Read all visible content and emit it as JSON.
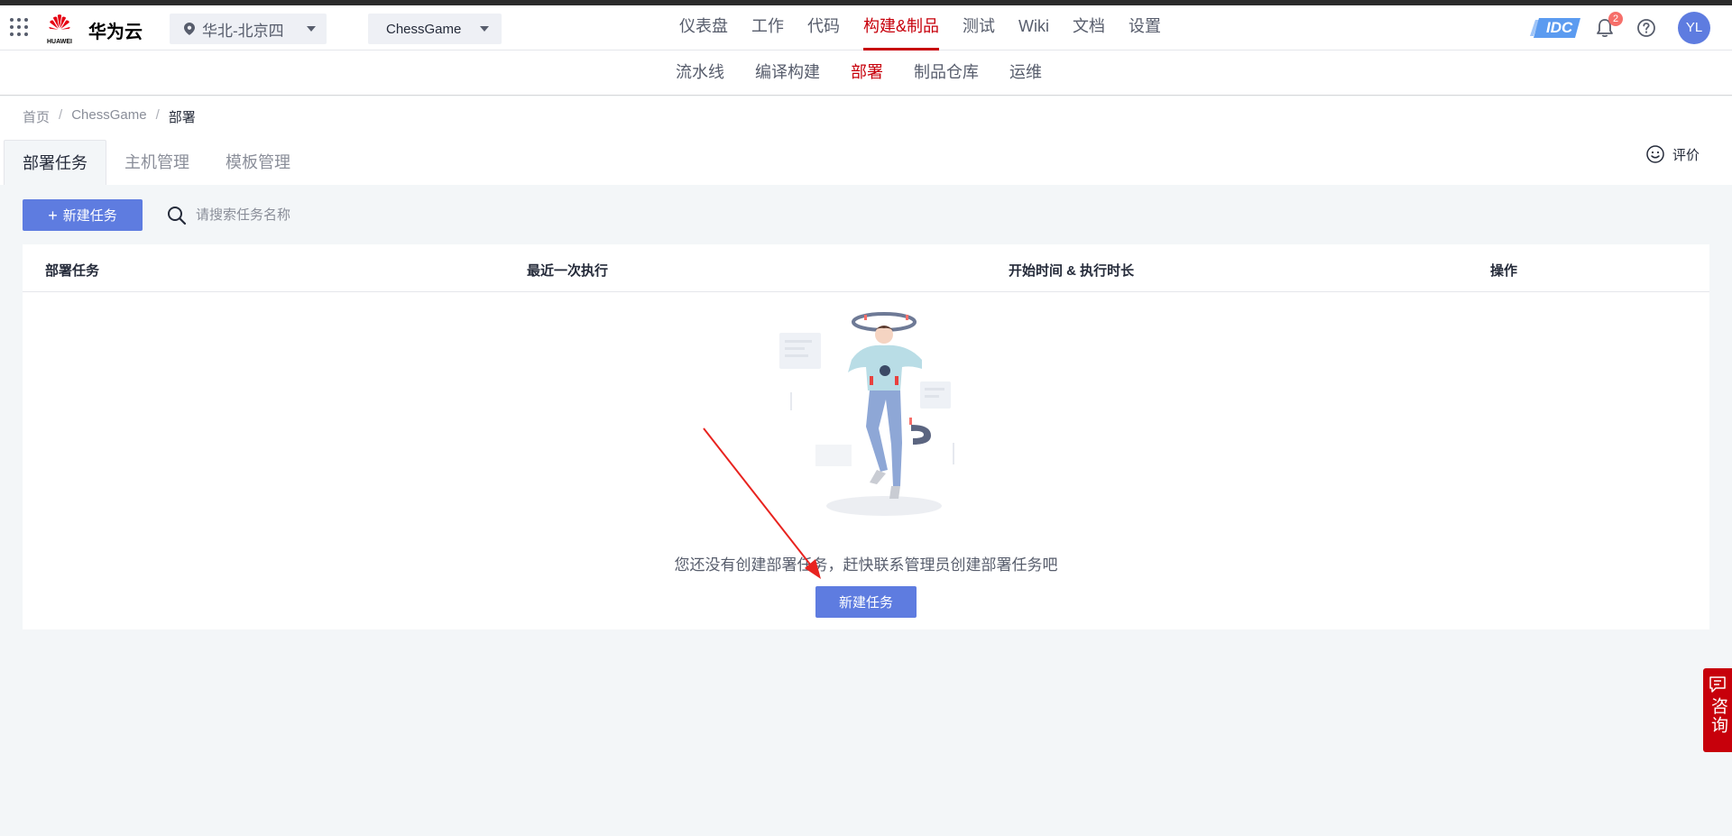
{
  "header": {
    "brand_text": "华为云",
    "logo_caption": "HUAWEI",
    "region": "华北-北京四",
    "project": "ChessGame",
    "menu": [
      {
        "label": "仪表盘",
        "active": false
      },
      {
        "label": "工作",
        "active": false
      },
      {
        "label": "代码",
        "active": false
      },
      {
        "label": "构建&制品",
        "active": true
      },
      {
        "label": "测试",
        "active": false
      },
      {
        "label": "Wiki",
        "active": false
      },
      {
        "label": "文档",
        "active": false
      },
      {
        "label": "设置",
        "active": false
      }
    ],
    "idc_badge": "IDC",
    "notification_count": "2",
    "avatar_initials": "YL"
  },
  "subnav": {
    "items": [
      {
        "label": "流水线",
        "active": false
      },
      {
        "label": "编译构建",
        "active": false
      },
      {
        "label": "部署",
        "active": true
      },
      {
        "label": "制品仓库",
        "active": false
      },
      {
        "label": "运维",
        "active": false
      }
    ]
  },
  "breadcrumb": {
    "home": "首页",
    "project": "ChessGame",
    "current": "部署",
    "separator": "/"
  },
  "tabs": [
    {
      "label": "部署任务",
      "active": true
    },
    {
      "label": "主机管理",
      "active": false
    },
    {
      "label": "模板管理",
      "active": false
    }
  ],
  "feedback_label": "评价",
  "toolbar": {
    "new_task_label": "新建任务",
    "search_placeholder": "请搜索任务名称"
  },
  "table": {
    "columns": [
      "部署任务",
      "最近一次执行",
      "开始时间 & 执行时长",
      "操作"
    ]
  },
  "empty_state": {
    "message": "您还没有创建部署任务，赶快联系管理员创建部署任务吧",
    "button_label": "新建任务"
  },
  "consult_label": "咨询",
  "colors": {
    "brand_red": "#c7000b",
    "primary_blue": "#5e7ce0",
    "page_bg": "#f3f6f8",
    "badge_red": "#f66f6a"
  }
}
